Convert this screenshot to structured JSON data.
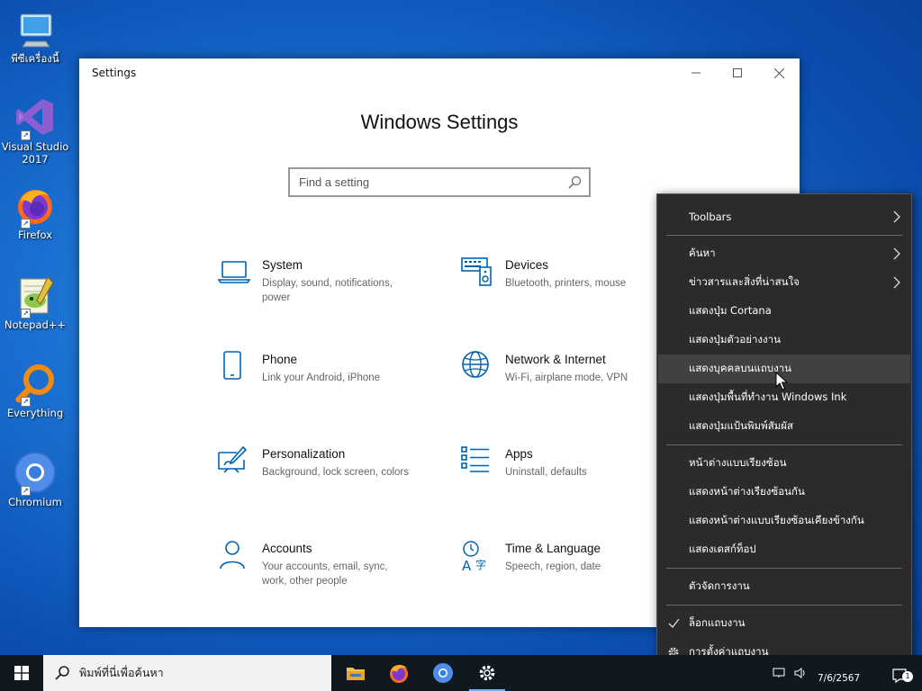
{
  "desktop": {
    "icons": [
      {
        "label": "พีซีเครื่องนี้"
      },
      {
        "label": "Visual Studio 2017"
      },
      {
        "label": "Firefox"
      },
      {
        "label": "Notepad++"
      },
      {
        "label": "Everything"
      },
      {
        "label": "Chromium"
      }
    ]
  },
  "settings_window": {
    "title": "Settings",
    "heading": "Windows Settings",
    "search_placeholder": "Find a setting",
    "categories": [
      {
        "name": "System",
        "desc": "Display, sound, notifications, power"
      },
      {
        "name": "Devices",
        "desc": "Bluetooth, printers, mouse"
      },
      {
        "name": "Phone",
        "desc": "Link your Android, iPhone"
      },
      {
        "name": "Network & Internet",
        "desc": "Wi-Fi, airplane mode, VPN"
      },
      {
        "name": "Personalization",
        "desc": "Background, lock screen, colors"
      },
      {
        "name": "Apps",
        "desc": "Uninstall, defaults"
      },
      {
        "name": "Accounts",
        "desc": "Your accounts, email, sync, work, other people"
      },
      {
        "name": "Time & Language",
        "desc": "Speech, region, date"
      }
    ]
  },
  "context_menu": {
    "items": [
      {
        "label": "Toolbars"
      },
      {
        "label": "ค้นหา"
      },
      {
        "label": "ข่าวสารและสิ่งที่น่าสนใจ"
      },
      {
        "label": "แสดงปุ่ม Cortana"
      },
      {
        "label": "แสดงปุ่มตัวอย่างงาน"
      },
      {
        "label": "แสดงบุคคลบนแถบงาน"
      },
      {
        "label": "แสดงปุ่มพื้นที่ทำงาน Windows Ink"
      },
      {
        "label": "แสดงปุ่มแป้นพิมพ์สัมผัส"
      },
      {
        "label": "หน้าต่างแบบเรียงซ้อน"
      },
      {
        "label": "แสดงหน้าต่างเรียงซ้อนกัน"
      },
      {
        "label": "แสดงหน้าต่างแบบเรียงซ้อนเคียงข้างกัน"
      },
      {
        "label": "แสดงเดสก์ท็อป"
      },
      {
        "label": "ตัวจัดการงาน"
      },
      {
        "label": "ล็อกแถบงาน"
      },
      {
        "label": "การตั้งค่าแถบงาน"
      }
    ]
  },
  "taskbar": {
    "search_placeholder": "พิมพ์ที่นี่เพื่อค้นหา",
    "date": "7/6/2567",
    "notification_count": "1"
  },
  "colors": {
    "accent": "#0063b1",
    "menu_bg": "#2b2b2b",
    "menu_hover": "#414141",
    "taskbar": "#101820"
  }
}
